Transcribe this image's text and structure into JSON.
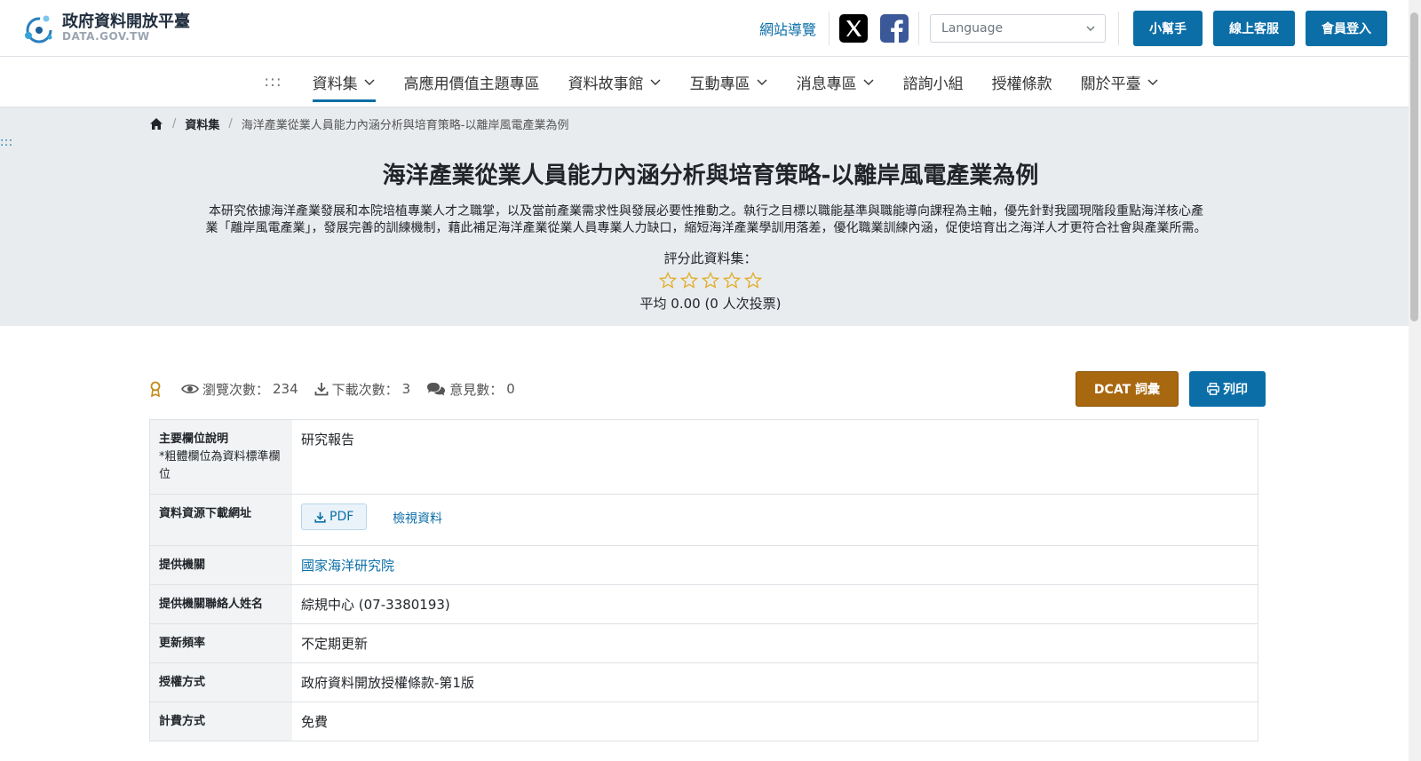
{
  "header": {
    "logo_cn": "政府資料開放平臺",
    "logo_en": "DATA.GOV.TW",
    "sitemap": "網站導覽",
    "language_placeholder": "Language",
    "buttons": [
      "小幫手",
      "線上客服",
      "會員登入"
    ]
  },
  "nav": {
    "dots": ":::",
    "items": [
      {
        "label": "資料集",
        "dropdown": true,
        "active": true
      },
      {
        "label": "高應用價值主題專區"
      },
      {
        "label": "資料故事館",
        "dropdown": true
      },
      {
        "label": "互動專區",
        "dropdown": true
      },
      {
        "label": "消息專區",
        "dropdown": true
      },
      {
        "label": "諮詢小組"
      },
      {
        "label": "授權條款"
      },
      {
        "label": "關於平臺",
        "dropdown": true
      }
    ]
  },
  "hero": {
    "side_dots": ":::",
    "breadcrumb": [
      "資料集",
      "海洋產業從業人員能力內涵分析與培育策略-以離岸風電產業為例"
    ],
    "title": "海洋產業從業人員能力內涵分析與培育策略-以離岸風電產業為例",
    "description_line1": "本研究依據海洋產業發展和本院培植專業人才之職掌，以及當前產業需求性與發展必要性推動之。執行之目標以職能基準與職能導向課程為主軸，優先針對我國現階段重點海洋核心產",
    "description_line2": "業「離岸風電產業」，發展完善的訓練機制，藉此補足海洋產業從業人員專業人力缺口，縮短海洋產業學訓用落差，優化職業訓練內涵，促使培育出之海洋人才更符合社會與產業所需。",
    "rate_label": "評分此資料集：",
    "rating_average": "平均 0.00 (0 人次投票)"
  },
  "stats": {
    "views_label": "瀏覽次數：",
    "views": "234",
    "downloads_label": "下載次數：",
    "downloads": "3",
    "comments_label": "意見數：",
    "comments": "0",
    "dcat_button": "DCAT 詞彙",
    "print_button": "列印"
  },
  "table": {
    "main_field_key": "主要欄位說明",
    "main_field_sub": "*粗體欄位為資料標準欄位",
    "main_field_value": "研究報告",
    "download_key": "資料資源下載網址",
    "pdf_label": "PDF",
    "view_data": "檢視資料",
    "rows": [
      {
        "key": "提供機關",
        "value": "國家海洋研究院"
      },
      {
        "key": "提供機關聯絡人姓名",
        "value": "綜規中心 (07-3380193)"
      },
      {
        "key": "更新頻率",
        "value": "不定期更新"
      },
      {
        "key": "授權方式",
        "value": "政府資料開放授權條款-第1版"
      },
      {
        "key": "計費方式",
        "value": "免費"
      }
    ]
  },
  "colors": {
    "primary": "#0b6ea7",
    "dcat": "#a8680f",
    "hero_bg": "#e9ecef",
    "star": "#e0b030"
  }
}
